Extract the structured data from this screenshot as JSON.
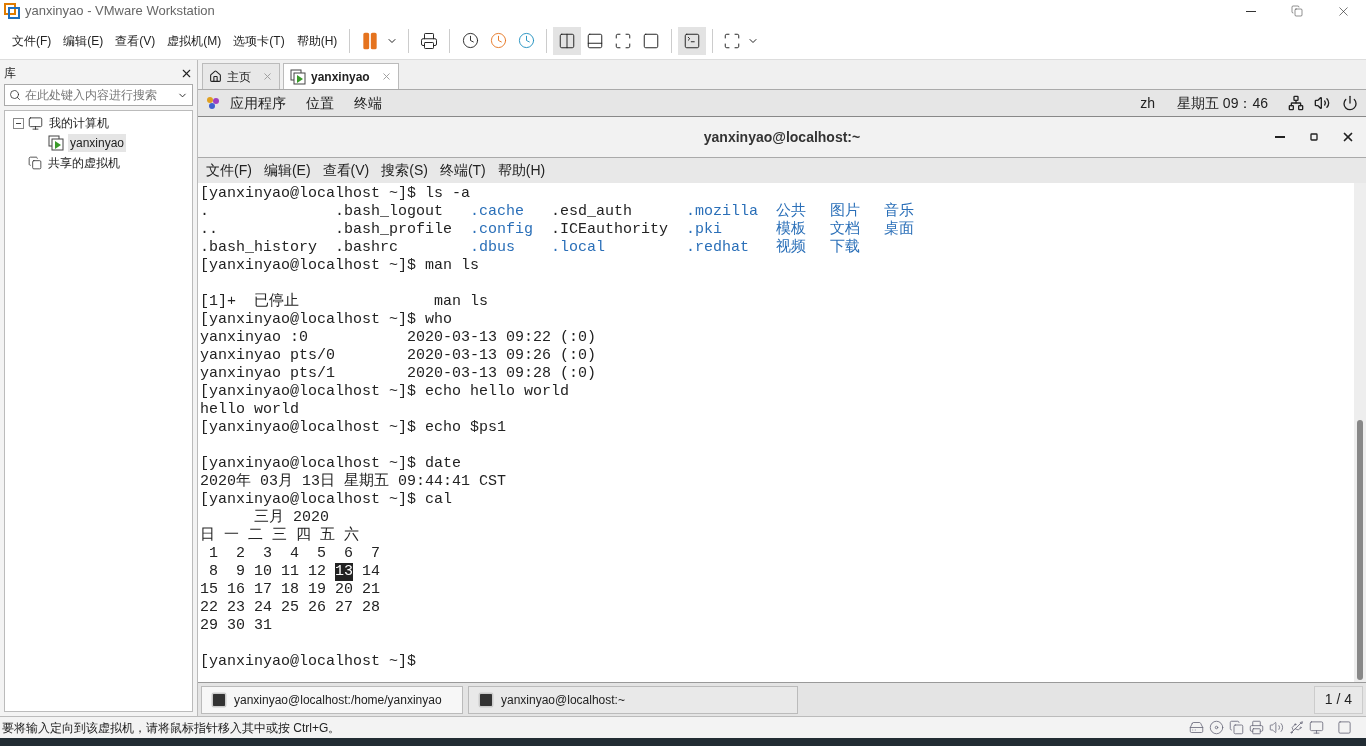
{
  "window": {
    "title": "yanxinyao - VMware Workstation"
  },
  "menu": [
    "文件(F)",
    "编辑(E)",
    "查看(V)",
    "虚拟机(M)",
    "选项卡(T)",
    "帮助(H)"
  ],
  "library": {
    "title": "库",
    "search": {
      "placeholder": "在此处键入内容进行搜索"
    },
    "tree": [
      {
        "label": "我的计算机",
        "kind": "computer",
        "expanded": true,
        "selected": false,
        "children": [
          {
            "label": "yanxinyao",
            "kind": "vm",
            "selected": true
          }
        ]
      },
      {
        "label": "共享的虚拟机",
        "kind": "shared",
        "selected": false
      }
    ]
  },
  "tabs": [
    {
      "label": "主页",
      "kind": "home",
      "selected": false
    },
    {
      "label": "yanxinyao",
      "kind": "vm",
      "selected": true
    }
  ],
  "guest_topbar": {
    "menus": [
      "应用程序",
      "位置",
      "终端"
    ],
    "input": "zh",
    "clock": "星期五 09：46"
  },
  "terminal": {
    "title": "yanxinyao@localhost:~",
    "menu": [
      "文件(F)",
      "编辑(E)",
      "查看(V)",
      "搜索(S)",
      "终端(T)",
      "帮助(H)"
    ],
    "lines": [
      {
        "kind": "text",
        "segments": [
          {
            "text": "[yanxinyao@localhost ~]$ ls -a",
            "kind": "plain"
          }
        ]
      },
      {
        "kind": "listing",
        "entries": [
          {
            "text": ".",
            "kind": "plain"
          },
          {
            "text": ".bash_logout",
            "kind": "plain"
          },
          {
            "text": ".cache",
            "kind": "dir"
          },
          {
            "text": ".esd_auth",
            "kind": "plain"
          },
          {
            "text": ".mozilla",
            "kind": "dir"
          },
          {
            "text": "公共",
            "kind": "dir"
          },
          {
            "text": "图片",
            "kind": "dir"
          },
          {
            "text": "音乐",
            "kind": "dir"
          }
        ]
      },
      {
        "kind": "listing",
        "entries": [
          {
            "text": "..",
            "kind": "plain"
          },
          {
            "text": ".bash_profile",
            "kind": "plain"
          },
          {
            "text": ".config",
            "kind": "dir"
          },
          {
            "text": ".ICEauthority",
            "kind": "plain"
          },
          {
            "text": ".pki",
            "kind": "dir"
          },
          {
            "text": "模板",
            "kind": "dir"
          },
          {
            "text": "文档",
            "kind": "dir"
          },
          {
            "text": "桌面",
            "kind": "dir"
          }
        ]
      },
      {
        "kind": "listing",
        "entries": [
          {
            "text": ".bash_history",
            "kind": "plain"
          },
          {
            "text": ".bashrc",
            "kind": "plain"
          },
          {
            "text": ".dbus",
            "kind": "dir"
          },
          {
            "text": ".local",
            "kind": "dir"
          },
          {
            "text": ".redhat",
            "kind": "dir"
          },
          {
            "text": "视频",
            "kind": "dir"
          },
          {
            "text": "下载",
            "kind": "dir"
          }
        ]
      },
      {
        "kind": "text",
        "segments": [
          {
            "text": "[yanxinyao@localhost ~]$ man ls",
            "kind": "plain"
          }
        ]
      },
      {
        "kind": "blank"
      },
      {
        "kind": "text",
        "segments": [
          {
            "text": "[1]+  已停止               man ls",
            "kind": "plain"
          }
        ]
      },
      {
        "kind": "text",
        "segments": [
          {
            "text": "[yanxinyao@localhost ~]$ who",
            "kind": "plain"
          }
        ]
      },
      {
        "kind": "text",
        "segments": [
          {
            "text": "yanxinyao :0           2020-03-13 09:22 (:0)",
            "kind": "plain"
          }
        ]
      },
      {
        "kind": "text",
        "segments": [
          {
            "text": "yanxinyao pts/0        2020-03-13 09:26 (:0)",
            "kind": "plain"
          }
        ]
      },
      {
        "kind": "text",
        "segments": [
          {
            "text": "yanxinyao pts/1        2020-03-13 09:28 (:0)",
            "kind": "plain"
          }
        ]
      },
      {
        "kind": "text",
        "segments": [
          {
            "text": "[yanxinyao@localhost ~]$ echo hello world",
            "kind": "plain"
          }
        ]
      },
      {
        "kind": "text",
        "segments": [
          {
            "text": "hello world",
            "kind": "plain"
          }
        ]
      },
      {
        "kind": "text",
        "segments": [
          {
            "text": "[yanxinyao@localhost ~]$ echo $ps1",
            "kind": "plain"
          }
        ]
      },
      {
        "kind": "blank"
      },
      {
        "kind": "text",
        "segments": [
          {
            "text": "[yanxinyao@localhost ~]$ date",
            "kind": "plain"
          }
        ]
      },
      {
        "kind": "text",
        "segments": [
          {
            "text": "2020年 03月 13日 星期五 09:44:41 CST",
            "kind": "plain"
          }
        ]
      },
      {
        "kind": "text",
        "segments": [
          {
            "text": "[yanxinyao@localhost ~]$ cal",
            "kind": "plain"
          }
        ]
      },
      {
        "kind": "text",
        "segments": [
          {
            "text": "      三月 2020",
            "kind": "plain"
          }
        ]
      },
      {
        "kind": "text",
        "segments": [
          {
            "text": "日 一 二 三 四 五 六",
            "kind": "plain"
          }
        ]
      },
      {
        "kind": "text",
        "segments": [
          {
            "text": " 1  2  3  4  5  6  7",
            "kind": "plain"
          }
        ]
      },
      {
        "kind": "text",
        "segments": [
          {
            "text": " 8  9 10 11 12",
            "kind": "plain"
          },
          {
            "text": "13",
            "kind": "highlight"
          },
          {
            "text": "14",
            "kind": "plain"
          }
        ]
      },
      {
        "kind": "text",
        "segments": [
          {
            "text": "15 16 17 18 19 20 21",
            "kind": "plain"
          }
        ]
      },
      {
        "kind": "text",
        "segments": [
          {
            "text": "22 23 24 25 26 27 28",
            "kind": "plain"
          }
        ]
      },
      {
        "kind": "text",
        "segments": [
          {
            "text": "29 30 31",
            "kind": "plain"
          }
        ]
      },
      {
        "kind": "blank"
      },
      {
        "kind": "text",
        "segments": [
          {
            "text": "[yanxinyao@localhost ~]$",
            "kind": "plain"
          }
        ]
      }
    ]
  },
  "guest_taskbar": {
    "windows": [
      {
        "label": "yanxinyao@localhost:/home/yanxinyao",
        "selected": false
      },
      {
        "label": "yanxinyao@localhost:~",
        "selected": true
      }
    ],
    "workspace": "1 / 4"
  },
  "status_bar": {
    "message": "要将输入定向到该虚拟机，请将鼠标指针移入其中或按 Ctrl+G。"
  }
}
